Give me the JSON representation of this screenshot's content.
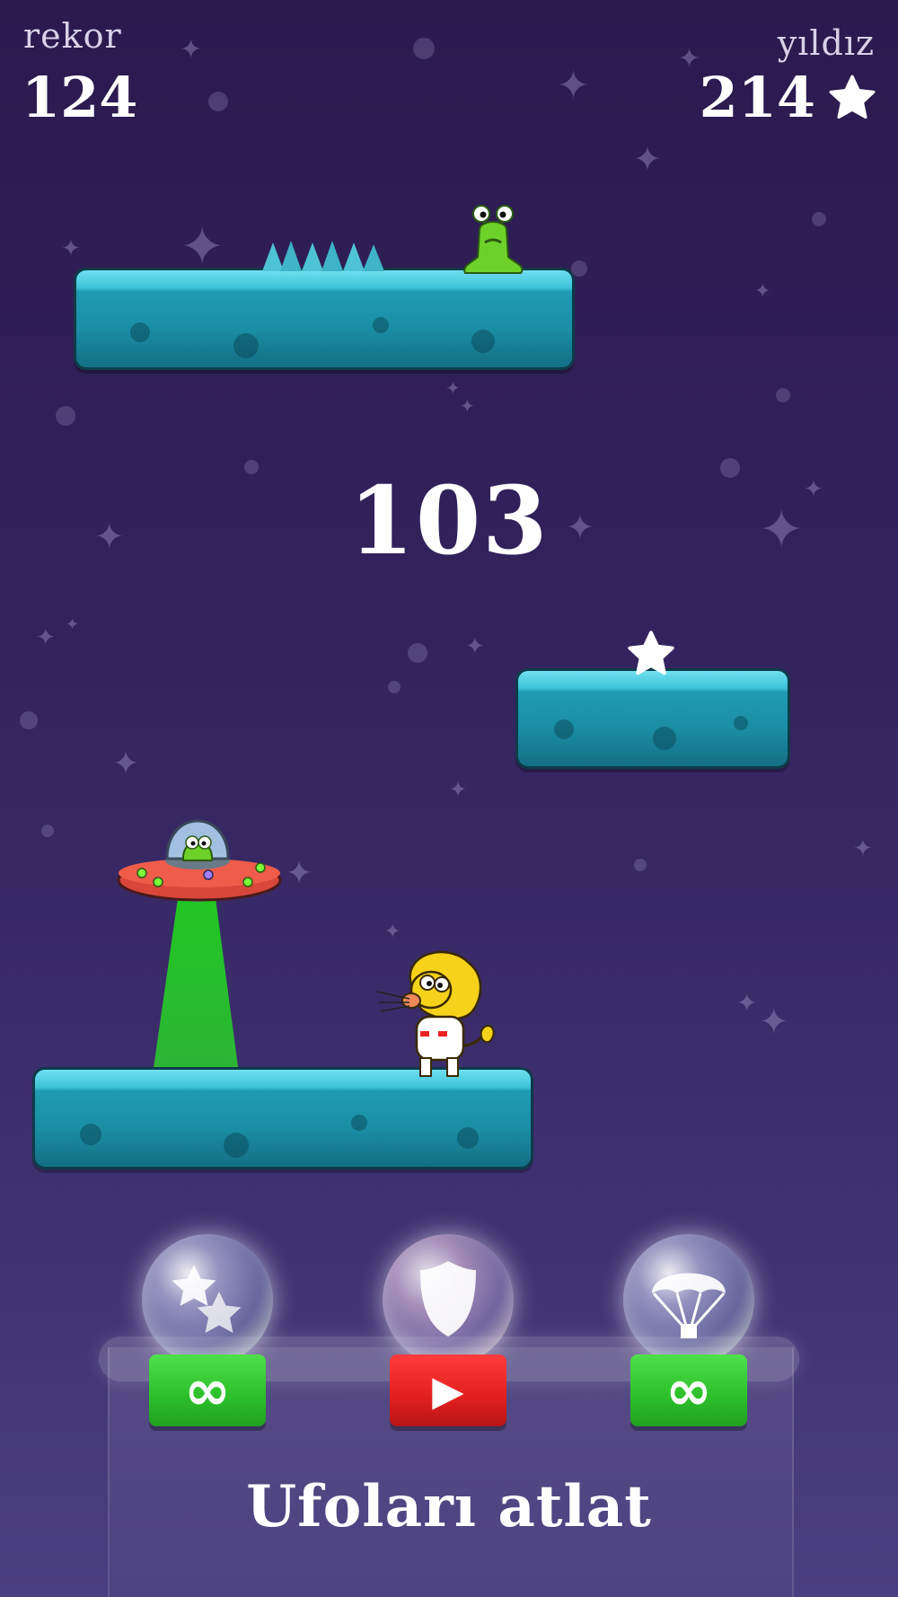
{
  "hud": {
    "record_label": "rekor",
    "record_value": "124",
    "stars_label": "yıldız",
    "stars_value": "214"
  },
  "score": "103",
  "powerups": [
    {
      "name": "double-stars",
      "icon": "double-star-icon",
      "button": "infinity",
      "button_glyph": "∞",
      "color": "#2cbf2a"
    },
    {
      "name": "shield",
      "icon": "shield-icon",
      "button": "video",
      "button_glyph": "▶",
      "color": "#e21f1f"
    },
    {
      "name": "parachute",
      "icon": "parachute-icon",
      "button": "infinity",
      "button_glyph": "∞",
      "color": "#2cbf2a"
    }
  ],
  "hint_text": "Ufoları atlat",
  "colors": {
    "background_top": "#2a1a4e",
    "background_bottom": "#4a3f80",
    "platform": "#1f9bb2",
    "ufo_beam": "#2bd42b",
    "lion": "#f7d21a"
  }
}
